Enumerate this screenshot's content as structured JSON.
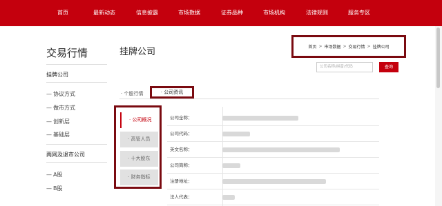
{
  "nav": {
    "items": [
      "首页",
      "最新动态",
      "信息披露",
      "市场数据",
      "证券品种",
      "市场机构",
      "法律规则",
      "服务专区"
    ]
  },
  "sidebar": {
    "title": "交易行情",
    "section1": "挂牌公司",
    "items1": [
      "协议方式",
      "做市方式",
      "创新层",
      "基础层"
    ],
    "section2": "两网及退市公司",
    "items2": [
      "A股",
      "B股"
    ],
    "dash": "—"
  },
  "main": {
    "title": "挂牌公司",
    "breadcrumb": [
      "首页",
      "市场数据",
      "交易行情",
      "挂牌公司"
    ],
    "breadcrumb_sep": ">",
    "search_placeholder": "公司名称/拼音/代码",
    "search_button": "查询",
    "tabs": [
      "· 个股行情",
      "· 公司资讯"
    ],
    "menu": [
      "· 公司概况",
      "· 高管人员",
      "· 十大股东",
      "· 财务指标"
    ],
    "info_labels": [
      "公司全称：",
      "公司代码：",
      "英文名称：",
      "公司简称：",
      "注册地址：",
      "法人代表："
    ]
  }
}
